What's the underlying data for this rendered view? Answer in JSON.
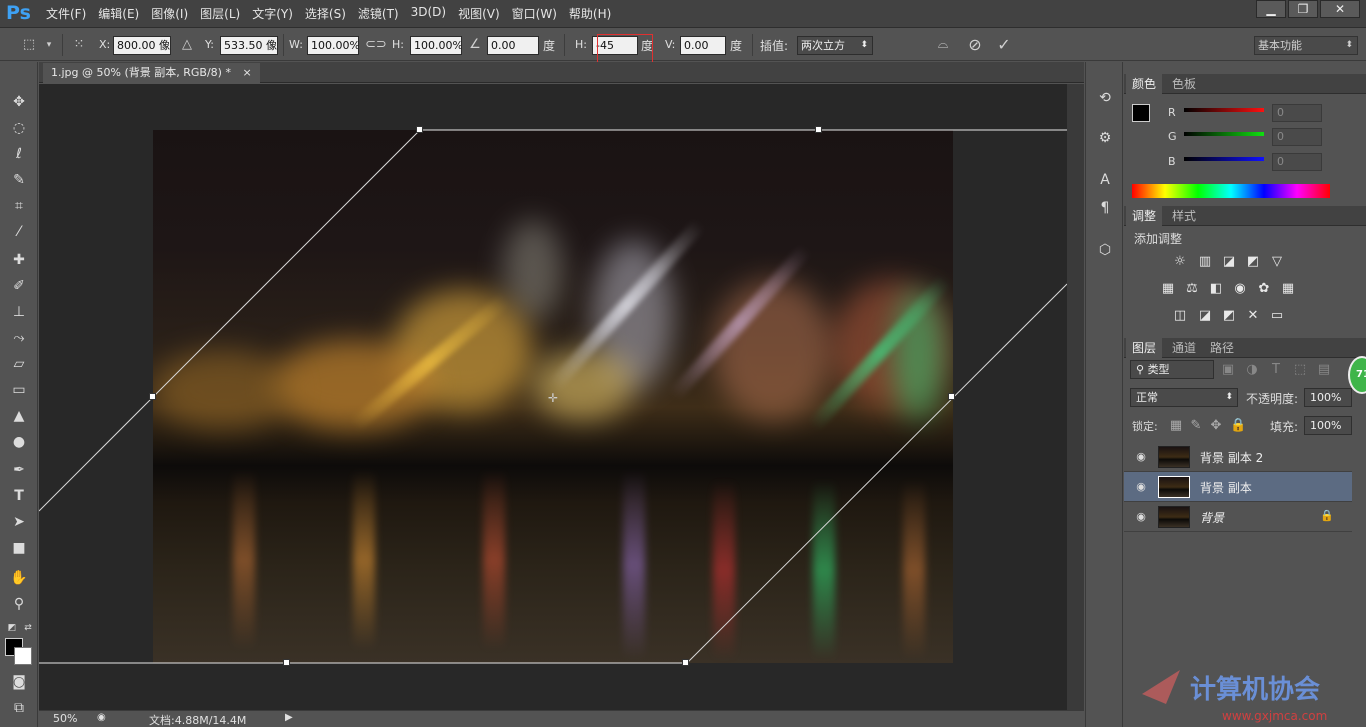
{
  "app": {
    "logo": "Ps"
  },
  "menu": [
    "文件(F)",
    "编辑(E)",
    "图像(I)",
    "图层(L)",
    "文字(Y)",
    "选择(S)",
    "滤镜(T)",
    "3D(D)",
    "视图(V)",
    "窗口(W)",
    "帮助(H)"
  ],
  "window_controls": {
    "minimize": "▁",
    "restore": "❐",
    "close": "✕"
  },
  "options": {
    "x_label": "X:",
    "x_value": "800.00 像",
    "y_label": "Y:",
    "y_value": "533.50 像",
    "w_label": "W:",
    "w_value": "100.00%",
    "h_label": "H:",
    "h_value": "100.00%",
    "angle_value": "0.00",
    "angle_unit": "度",
    "hskew_label": "H:",
    "hskew_value": "-45",
    "hskew_unit": "度",
    "vskew_label": "V:",
    "vskew_value": "0.00",
    "vskew_unit": "度",
    "interp_label": "插值:",
    "interp_value": "两次立方",
    "workspace": "基本功能"
  },
  "document": {
    "tab_title": "1.jpg @ 50% (背景 副本, RGB/8) *",
    "tab_close": "×"
  },
  "status": {
    "zoom": "50%",
    "doc_info": "文档:4.88M/14.4M"
  },
  "color_panel": {
    "tabs": [
      "颜色",
      "色板"
    ],
    "channels": [
      {
        "label": "R",
        "value": "0",
        "color": "#e02020"
      },
      {
        "label": "G",
        "value": "0",
        "color": "#20c020"
      },
      {
        "label": "B",
        "value": "0",
        "color": "#2020e0"
      }
    ]
  },
  "adjust_panel": {
    "tabs": [
      "调整",
      "样式"
    ],
    "title": "添加调整"
  },
  "layers_panel": {
    "tabs": [
      "图层",
      "通道",
      "路径"
    ],
    "filter_kind": "类型",
    "blend_mode": "正常",
    "opacity_label": "不透明度:",
    "opacity_value": "100%",
    "lock_label": "锁定:",
    "fill_label": "填充:",
    "fill_value": "100%",
    "layers": [
      {
        "name": "背景 副本 2",
        "selected": false
      },
      {
        "name": "背景 副本",
        "selected": true
      },
      {
        "name": "背景",
        "selected": false,
        "locked": true
      }
    ]
  },
  "badge_text": "71",
  "watermark": {
    "text": "计算机协会",
    "url": "www.gxjmca.com"
  },
  "colors": {
    "panel_bg": "#535353",
    "selected_layer": "#5c6b82",
    "accent_red": "#e03030"
  }
}
